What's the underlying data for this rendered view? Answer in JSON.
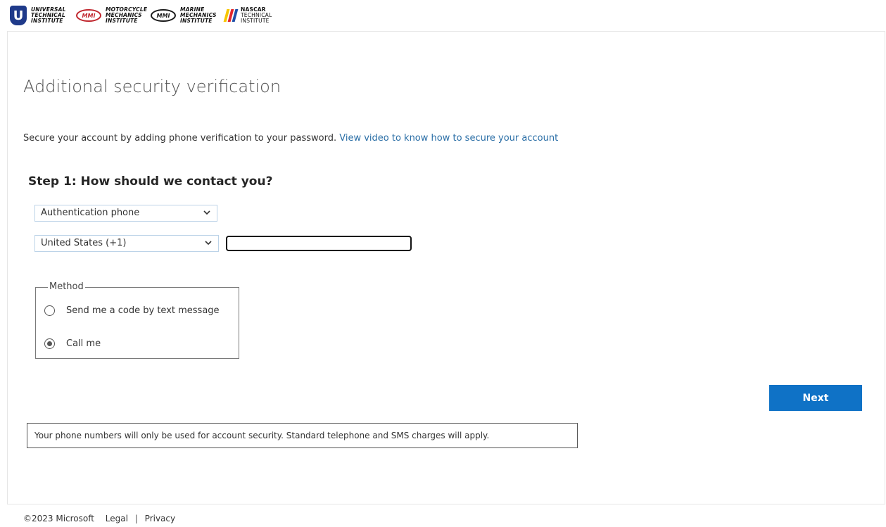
{
  "header": {
    "logos": [
      {
        "name": "uti",
        "mark": "U",
        "lines": [
          "Universal",
          "Technical",
          "Institute"
        ]
      },
      {
        "name": "mmi-motorcycle",
        "mark": "MMI",
        "lines": [
          "Motorcycle",
          "Mechanics",
          "Institute"
        ]
      },
      {
        "name": "mmi-marine",
        "mark": "MMI",
        "lines": [
          "Marine",
          "Mechanics",
          "Institute"
        ]
      },
      {
        "name": "nascar",
        "lines": [
          "NASCAR",
          "Technical",
          "Institute"
        ]
      }
    ]
  },
  "page": {
    "title": "Additional security verification",
    "intro_text": "Secure your account by adding phone verification to your password. ",
    "intro_link": "View video to know how to secure your account"
  },
  "step1": {
    "title": "Step 1: How should we contact you?",
    "contact_method": "Authentication phone",
    "country": "United States (+1)",
    "phone_value": "",
    "method_legend": "Method",
    "options": [
      {
        "label": "Send me a code by text message",
        "selected": false
      },
      {
        "label": "Call me",
        "selected": true
      }
    ]
  },
  "actions": {
    "next_label": "Next"
  },
  "notice": "Your phone numbers will only be used for account security. Standard telephone and SMS charges will apply.",
  "footer": {
    "copyright": "©2023 Microsoft",
    "legal": "Legal",
    "separator": "|",
    "privacy": "Privacy"
  },
  "colors": {
    "primary_button": "#0f72c6",
    "link": "#2a6ea6",
    "nascar_stripes": [
      "#f7c600",
      "#e3262b",
      "#1f4fa8"
    ]
  }
}
